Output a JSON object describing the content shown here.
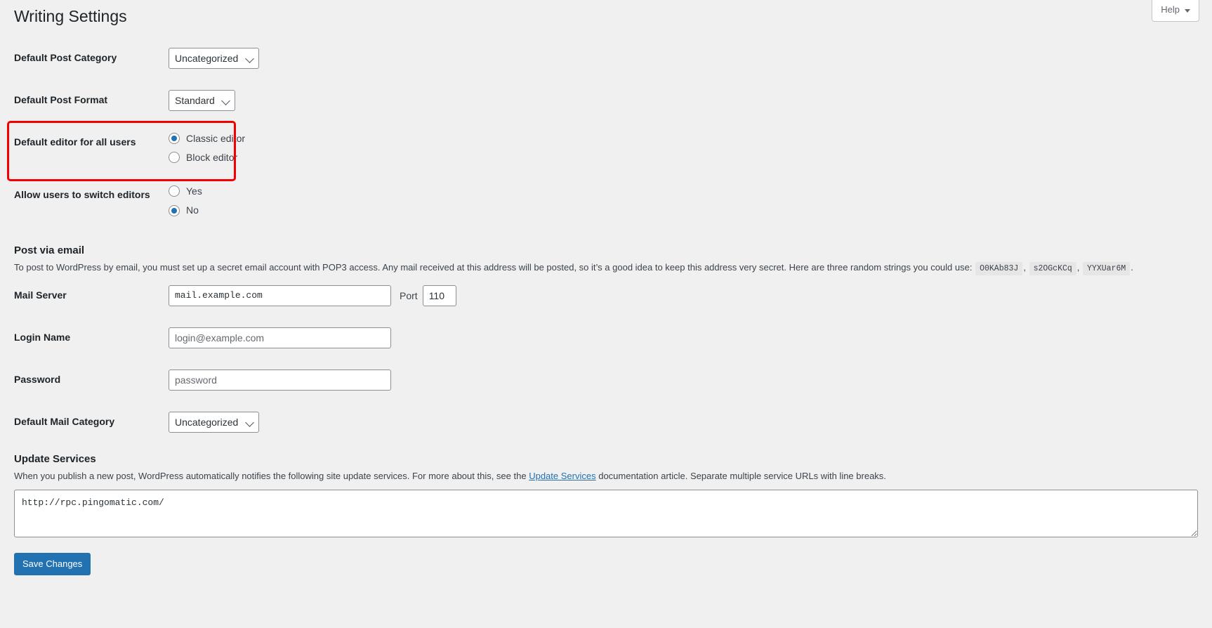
{
  "help_tab": {
    "label": "Help",
    "caret_icon": "chevron-down-icon"
  },
  "page": {
    "title": "Writing Settings"
  },
  "settings": {
    "default_post_category": {
      "label": "Default Post Category",
      "value": "Uncategorized",
      "options": [
        "Uncategorized"
      ]
    },
    "default_post_format": {
      "label": "Default Post Format",
      "value": "Standard",
      "options": [
        "Standard"
      ]
    },
    "default_editor": {
      "label": "Default editor for all users",
      "options": [
        {
          "label": "Classic editor",
          "checked": true
        },
        {
          "label": "Block editor",
          "checked": false
        }
      ]
    },
    "allow_switch_editors": {
      "label": "Allow users to switch editors",
      "options": [
        {
          "label": "Yes",
          "checked": false
        },
        {
          "label": "No",
          "checked": true
        }
      ]
    }
  },
  "post_via_email": {
    "title": "Post via email",
    "description_part1": "To post to WordPress by email, you must set up a secret email account with POP3 access. Any mail received at this address will be posted, so it’s a good idea to keep this address very secret. Here are three random strings you could use:",
    "random_strings": [
      "O0KAb83J",
      "s2OGcKCq",
      "YYXUar6M"
    ],
    "separator": ",",
    "period": ".",
    "mail_server": {
      "label": "Mail Server",
      "value": "mail.example.com",
      "port_label": "Port",
      "port_value": "110"
    },
    "login_name": {
      "label": "Login Name",
      "placeholder": "login@example.com",
      "value": ""
    },
    "password": {
      "label": "Password",
      "placeholder": "password",
      "value": ""
    },
    "default_mail_category": {
      "label": "Default Mail Category",
      "value": "Uncategorized",
      "options": [
        "Uncategorized"
      ]
    }
  },
  "update_services": {
    "title": "Update Services",
    "description_before_link": "When you publish a new post, WordPress automatically notifies the following site update services. For more about this, see the",
    "link_text": "Update Services",
    "description_after_link": "documentation article. Separate multiple service URLs with line breaks.",
    "textarea_value": "http://rpc.pingomatic.com/"
  },
  "submit": {
    "label": "Save Changes"
  },
  "colors": {
    "accent": "#2271b1",
    "page_bg": "#f0f0f1",
    "highlight": "#f40000",
    "text": "#3c434a",
    "heading": "#1d2327"
  }
}
